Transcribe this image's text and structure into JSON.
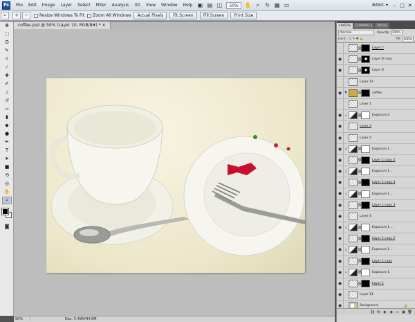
{
  "app": {
    "logo": "Ps"
  },
  "menus": [
    "File",
    "Edit",
    "Image",
    "Layer",
    "Select",
    "Filter",
    "Analysis",
    "3D",
    "View",
    "Window",
    "Help"
  ],
  "menubar_right": {
    "zoom": "50%",
    "workspace": "BASIC ▾",
    "icons": [
      "hand-icon",
      "zoom-icon",
      "rotate-icon",
      "grid-icon",
      "screen-mode-icon"
    ]
  },
  "options": {
    "resize_windows": "Resize Windows To Fit",
    "zoom_all": "Zoom All Windows",
    "actual_pixels": "Actual Pixels",
    "fit_screen": "Fit Screen",
    "fill_screen": "Fill Screen",
    "print_size": "Print Size"
  },
  "document": {
    "tab_title": "coffee.psd @ 50% (Layer 10, RGB/8#) *"
  },
  "status": {
    "zoom": "50%",
    "doc_info": "Doc: 5.49M/44.6M"
  },
  "panel": {
    "tabs": [
      "LAYERS",
      "CHANNELS",
      "PATHS"
    ],
    "blend_mode": "Normal",
    "opacity_label": "Opacity:",
    "opacity": "100%",
    "lock_label": "Lock:",
    "fill_label": "Fill:",
    "fill": "100%",
    "layers": [
      {
        "name": "Layer 7",
        "eye": false,
        "mask": "black",
        "thumb": "pixel",
        "u": true
      },
      {
        "name": "Layer 8 copy",
        "eye": true,
        "mask": "partial",
        "thumb": "pixel",
        "u": false
      },
      {
        "name": "Layer 8",
        "eye": true,
        "mask": "partial",
        "thumb": "pixel",
        "u": false
      },
      {
        "name": "Layer 12",
        "eye": false,
        "mask": "",
        "thumb": "pixel",
        "u": false
      },
      {
        "name": "coffee",
        "eye": true,
        "mask": "black",
        "thumb": "folder",
        "u": false
      },
      {
        "name": "Layer 1",
        "eye": false,
        "mask": "",
        "thumb": "pixel",
        "u": false
      },
      {
        "name": "Exposure 2",
        "eye": true,
        "mask": "white",
        "thumb": "adj",
        "u": false
      },
      {
        "name": "Layer 3",
        "eye": true,
        "mask": "",
        "thumb": "pixel",
        "u": true
      },
      {
        "name": "Layer 2",
        "eye": true,
        "mask": "",
        "thumb": "pixel",
        "u": false
      },
      {
        "name": "Exposure 1 ...",
        "eye": true,
        "mask": "white",
        "thumb": "adj",
        "u": false
      },
      {
        "name": "Layer 1 copy 5",
        "eye": true,
        "mask": "black",
        "thumb": "pixel",
        "u": true
      },
      {
        "name": "Exposure 1 ...",
        "eye": true,
        "mask": "white",
        "thumb": "adj",
        "u": false
      },
      {
        "name": "Layer 1 copy 4",
        "eye": true,
        "mask": "black",
        "thumb": "pixel",
        "u": true
      },
      {
        "name": "Exposure 1 ...",
        "eye": true,
        "mask": "white",
        "thumb": "adj",
        "u": false
      },
      {
        "name": "Layer 1 copy 3",
        "eye": true,
        "mask": "black",
        "thumb": "pixel",
        "u": true
      },
      {
        "name": "Layer 4",
        "eye": true,
        "mask": "",
        "thumb": "pixel",
        "u": false
      },
      {
        "name": "Exposure 1 ...",
        "eye": true,
        "mask": "white",
        "thumb": "adj",
        "u": false
      },
      {
        "name": "Layer 1 copy 2",
        "eye": true,
        "mask": "black",
        "thumb": "pixel",
        "u": true
      },
      {
        "name": "Exposure 1 ...",
        "eye": true,
        "mask": "white",
        "thumb": "adj",
        "u": false
      },
      {
        "name": "Layer 1 copy",
        "eye": true,
        "mask": "black",
        "thumb": "pixel",
        "u": true
      },
      {
        "name": "Exposure 1",
        "eye": true,
        "mask": "white",
        "thumb": "adj",
        "u": false
      },
      {
        "name": "Layer 1",
        "eye": true,
        "mask": "black",
        "thumb": "pixel",
        "u": true
      },
      {
        "name": "Layer 11",
        "eye": true,
        "mask": "",
        "thumb": "pixel",
        "u": false
      },
      {
        "name": "Background",
        "eye": true,
        "mask": "",
        "thumb": "bgimg",
        "u": false,
        "locked": true
      }
    ]
  }
}
